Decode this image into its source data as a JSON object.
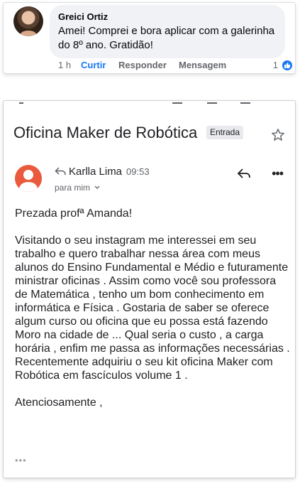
{
  "comment": {
    "author": "Greici Ortiz",
    "text": "Amei! Comprei e bora aplicar com a galerinha do 8º ano. Gratidão!",
    "time": "1 h",
    "actions": {
      "like": "Curtir",
      "reply": "Responder",
      "message": "Mensagem"
    },
    "reaction_count": "1",
    "colors": {
      "bubble": "#f0f2f5",
      "like_blue": "#1877f2",
      "meta_gray": "#65676b"
    }
  },
  "email": {
    "subject": "Oficina Maker de Robótica",
    "label": "Entrada",
    "sender_name": "Karlla Lima",
    "time": "09:53",
    "recipient": "para mim",
    "greeting": "Prezada  profª Amanda!",
    "body": "Visitando o seu  instagram me  interessei em seu trabalho e  quero   trabalhar nessa área com meus alunos do Ensino  Fundamental e Médio e futuramente ministrar oficinas  . Assim como você sou professora de Matemática , tenho um bom conhecimento em informática e Física . Gostaria de saber se oferece algum curso ou oficina que eu possa está fazendo Moro  na cidade de ... Qual seria o custo , a carga horária , enfim me passa as informações necessárias . Recentemente adquiriu o seu kit oficina Maker com Robótica em  fascículos volume 1 .",
    "signoff": "Atenciosamente ,",
    "icons": [
      "star-icon",
      "reply-icon",
      "more-icon",
      "ellipsis-icon"
    ],
    "colors": {
      "avatar": "#ea5a3c",
      "chip": "#e8eaed"
    }
  }
}
